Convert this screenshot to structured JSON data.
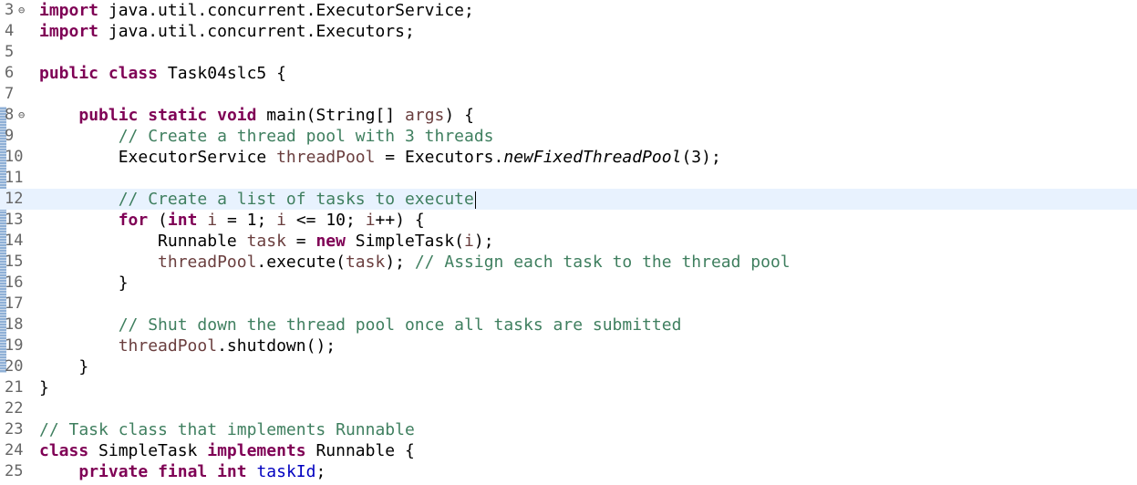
{
  "editor": {
    "fold_glyph": "⊖",
    "lines": [
      {
        "num": "3",
        "fold": true,
        "tokens": [
          {
            "t": "import",
            "c": "kw"
          },
          {
            "t": " java.util.concurrent.ExecutorService;",
            "c": ""
          }
        ]
      },
      {
        "num": "4",
        "tokens": [
          {
            "t": "import",
            "c": "kw"
          },
          {
            "t": " java.util.concurrent.Executors;",
            "c": ""
          }
        ]
      },
      {
        "num": "5",
        "tokens": []
      },
      {
        "num": "6",
        "tokens": [
          {
            "t": "public",
            "c": "kw"
          },
          {
            "t": " ",
            "c": ""
          },
          {
            "t": "class",
            "c": "kw"
          },
          {
            "t": " Task04slc5 {",
            "c": ""
          }
        ]
      },
      {
        "num": "7",
        "tokens": []
      },
      {
        "num": "8",
        "fold": true,
        "tokens": [
          {
            "t": "    ",
            "c": ""
          },
          {
            "t": "public",
            "c": "kw"
          },
          {
            "t": " ",
            "c": ""
          },
          {
            "t": "static",
            "c": "kw"
          },
          {
            "t": " ",
            "c": ""
          },
          {
            "t": "void",
            "c": "kw"
          },
          {
            "t": " main(String[] ",
            "c": ""
          },
          {
            "t": "args",
            "c": "var"
          },
          {
            "t": ") {",
            "c": ""
          }
        ]
      },
      {
        "num": "9",
        "tokens": [
          {
            "t": "        ",
            "c": ""
          },
          {
            "t": "// Create a thread pool with 3 threads",
            "c": "cm"
          }
        ]
      },
      {
        "num": "10",
        "tokens": [
          {
            "t": "        ExecutorService ",
            "c": ""
          },
          {
            "t": "threadPool",
            "c": "var"
          },
          {
            "t": " = Executors.",
            "c": ""
          },
          {
            "t": "newFixedThreadPool",
            "c": "st"
          },
          {
            "t": "(3);",
            "c": ""
          }
        ]
      },
      {
        "num": "11",
        "tokens": []
      },
      {
        "num": "12",
        "current": true,
        "caret": true,
        "tokens": [
          {
            "t": "        ",
            "c": ""
          },
          {
            "t": "// Create a list of tasks to execute",
            "c": "cm"
          }
        ]
      },
      {
        "num": "13",
        "tokens": [
          {
            "t": "        ",
            "c": ""
          },
          {
            "t": "for",
            "c": "kw"
          },
          {
            "t": " (",
            "c": ""
          },
          {
            "t": "int",
            "c": "kw"
          },
          {
            "t": " ",
            "c": ""
          },
          {
            "t": "i",
            "c": "var"
          },
          {
            "t": " = 1; ",
            "c": ""
          },
          {
            "t": "i",
            "c": "var"
          },
          {
            "t": " <= 10; ",
            "c": ""
          },
          {
            "t": "i",
            "c": "var"
          },
          {
            "t": "++) {",
            "c": ""
          }
        ]
      },
      {
        "num": "14",
        "tokens": [
          {
            "t": "            Runnable ",
            "c": ""
          },
          {
            "t": "task",
            "c": "var"
          },
          {
            "t": " = ",
            "c": ""
          },
          {
            "t": "new",
            "c": "kw"
          },
          {
            "t": " SimpleTask(",
            "c": ""
          },
          {
            "t": "i",
            "c": "var"
          },
          {
            "t": ");",
            "c": ""
          }
        ]
      },
      {
        "num": "15",
        "tokens": [
          {
            "t": "            ",
            "c": ""
          },
          {
            "t": "threadPool",
            "c": "var"
          },
          {
            "t": ".execute(",
            "c": ""
          },
          {
            "t": "task",
            "c": "var"
          },
          {
            "t": "); ",
            "c": ""
          },
          {
            "t": "// Assign each task to the thread pool",
            "c": "cm"
          }
        ]
      },
      {
        "num": "16",
        "tokens": [
          {
            "t": "        }",
            "c": ""
          }
        ]
      },
      {
        "num": "17",
        "tokens": []
      },
      {
        "num": "18",
        "tokens": [
          {
            "t": "        ",
            "c": ""
          },
          {
            "t": "// Shut down the thread pool once all tasks are submitted",
            "c": "cm"
          }
        ]
      },
      {
        "num": "19",
        "tokens": [
          {
            "t": "        ",
            "c": ""
          },
          {
            "t": "threadPool",
            "c": "var"
          },
          {
            "t": ".shutdown();",
            "c": ""
          }
        ]
      },
      {
        "num": "20",
        "tokens": [
          {
            "t": "    }",
            "c": ""
          }
        ]
      },
      {
        "num": "21",
        "tokens": [
          {
            "t": "}",
            "c": ""
          }
        ]
      },
      {
        "num": "22",
        "tokens": []
      },
      {
        "num": "23",
        "tokens": [
          {
            "t": "// Task class that implements Runnable",
            "c": "cm"
          }
        ]
      },
      {
        "num": "24",
        "tokens": [
          {
            "t": "class",
            "c": "kw"
          },
          {
            "t": " SimpleTask ",
            "c": ""
          },
          {
            "t": "implements",
            "c": "kw"
          },
          {
            "t": " Runnable {",
            "c": ""
          }
        ]
      },
      {
        "num": "25",
        "tokens": [
          {
            "t": "    ",
            "c": ""
          },
          {
            "t": "private",
            "c": "kw"
          },
          {
            "t": " ",
            "c": ""
          },
          {
            "t": "final",
            "c": "kw"
          },
          {
            "t": " ",
            "c": ""
          },
          {
            "t": "int",
            "c": "kw"
          },
          {
            "t": " ",
            "c": ""
          },
          {
            "t": "taskId",
            "c": "fld"
          },
          {
            "t": ";",
            "c": ""
          }
        ]
      }
    ]
  }
}
